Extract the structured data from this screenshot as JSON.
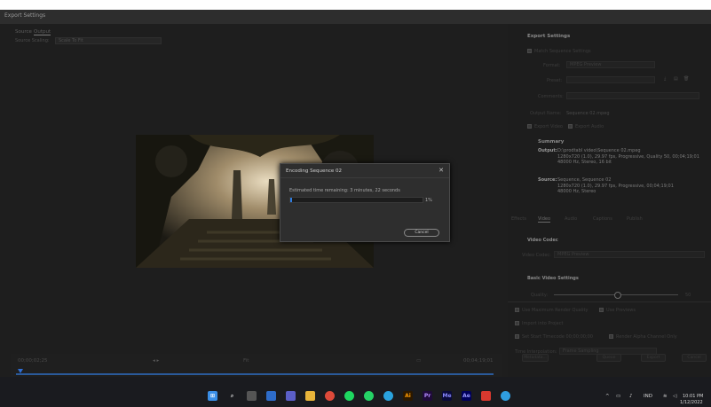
{
  "window": {
    "title": "Export Settings"
  },
  "left": {
    "tabs": [
      "Source",
      "Output"
    ],
    "scaling_label": "Source Scaling:",
    "scaling_value": "Scale To Fit",
    "timecode_start": "00;00;02;25",
    "fit_label": "Fit",
    "timecode_end": "00;04;19;01"
  },
  "dialog": {
    "title": "Encoding Sequence 02",
    "close": "✕",
    "message": "Estimated time remaining: 3 minutes, 22 seconds",
    "progress": 0.01,
    "percent": "1%",
    "cancel": "Cancel"
  },
  "right": {
    "export_settings_heading": "Export Settings",
    "match_sequence": "Match Sequence Settings",
    "format_label": "Format:",
    "format_value": "MPEG Preview",
    "preset_label": "Preset:",
    "comments_label": "Comments:",
    "output_name_label": "Output Name:",
    "output_name_value": "Sequence 02.mpeg",
    "export_video": "Export Video",
    "export_audio": "Export Audio",
    "summary_heading": "Summary",
    "output_label": "Output:",
    "output_lines": [
      "D:\\prodtabl video\\Sequence 02.mpeg",
      "1280x720 (1.0), 29.97 fps, Progressive, Quality 50, 00;04;19;01",
      "48000 Hz, Stereo, 16 bit"
    ],
    "source_label": "Source:",
    "source_lines": [
      "Sequence, Sequence 02",
      "1280x720 (1.0), 29.97 fps, Progressive, 00;04;19;01",
      "48000 Hz, Stereo"
    ],
    "tabs": [
      "Effects",
      "Video",
      "Audio",
      "Captions",
      "Publish"
    ],
    "video_codec_heading": "Video Codec",
    "video_codec_label": "Video Codec:",
    "video_codec_value": "MPEG Preview",
    "basic_video_heading": "Basic Video Settings",
    "quality_label": "Quality:",
    "quality_value": "50",
    "use_max_render": "Use Maximum Render Quality",
    "use_previews": "Use Previews",
    "import_project": "Import into Project",
    "set_start_timecode": "Set Start Timecode 00;00;00;00",
    "render_alpha": "Render Alpha Channel Only",
    "time_interp_label": "Time Interpolation:",
    "time_interp_value": "Frame Sampling",
    "buttons": [
      "Metadata...",
      "Queue",
      "Export",
      "Cancel"
    ]
  },
  "taskbar": {
    "apps": [
      "start",
      "search",
      "task-view",
      "widgets",
      "teams",
      "file-explorer",
      "chrome",
      "spotify",
      "whatsapp",
      "telegram",
      "illustrator",
      "premiere",
      "media-encoder",
      "after-effects",
      "wps",
      "app"
    ],
    "labels": {
      "illustrator": "Ai",
      "premiere": "Pr",
      "media_encoder": "Me",
      "after_effects": "Ae"
    },
    "lang": "IND",
    "time": "10:01 PM",
    "date": "1/12/2022"
  },
  "colors": {
    "accent": "#2f7de1",
    "dialog_bg": "#2e2e2e",
    "panel_bg": "#1d1d1d"
  }
}
